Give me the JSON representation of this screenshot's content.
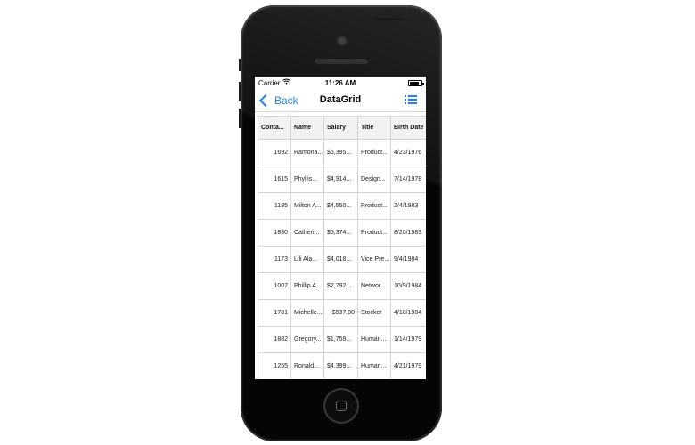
{
  "status_bar": {
    "carrier": "Carrier",
    "time": "11:26 AM",
    "battery_level": 0.85
  },
  "nav": {
    "back_label": "Back",
    "title": "DataGrid"
  },
  "grid": {
    "columns": [
      "Conta...",
      "Name",
      "Salary",
      "Title",
      "Birth Date"
    ],
    "rows": [
      [
        "1692",
        "Ramona...",
        "$5,395...",
        "Product...",
        "4/23/1976"
      ],
      [
        "1615",
        "Phyllis...",
        "$4,914...",
        "Design...",
        "7/14/1978"
      ],
      [
        "1135",
        "Milton A...",
        "$4,550...",
        "Product...",
        "2/4/1983"
      ],
      [
        "1830",
        "Catheri...",
        "$5,374...",
        "Product...",
        "8/20/1983"
      ],
      [
        "1173",
        "Lili Ala...",
        "$4,018...",
        "Vice Pre...",
        "9/4/1984"
      ],
      [
        "1007",
        "Phillip A...",
        "$2,792...",
        "Networ...",
        "10/9/1984"
      ],
      [
        "1781",
        "Michelle...",
        "$537.00",
        "Stocker",
        "4/10/1984"
      ],
      [
        "1882",
        "Gregory...",
        "$1,759...",
        "Human...",
        "1/14/1979"
      ],
      [
        "1255",
        "Ronald...",
        "$4,399...",
        "Human...",
        "4/21/1979"
      ]
    ]
  },
  "colors": {
    "accent": "#1a82fb",
    "phone_body": "#050505",
    "header_bg": "#f2f2f2",
    "grid_line": "#d4d4d4"
  }
}
